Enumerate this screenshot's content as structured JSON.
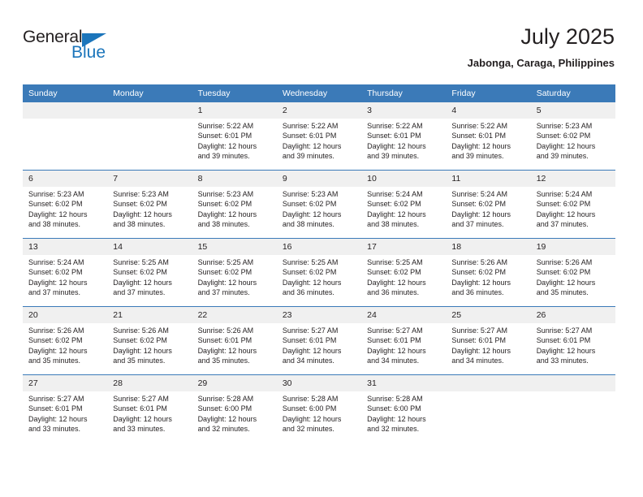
{
  "brand": {
    "name_dark": "General",
    "name_blue": "Blue",
    "accent_color": "#1b75bb"
  },
  "header": {
    "title": "July 2025",
    "subtitle": "Jabonga, Caraga, Philippines"
  },
  "calendar": {
    "header_color": "#3b7ab8",
    "daynum_band_color": "#f0f0f0",
    "weekday_headers": [
      "Sunday",
      "Monday",
      "Tuesday",
      "Wednesday",
      "Thursday",
      "Friday",
      "Saturday"
    ],
    "weeks": [
      [
        {
          "day": "",
          "lines": []
        },
        {
          "day": "",
          "lines": []
        },
        {
          "day": "1",
          "lines": [
            "Sunrise: 5:22 AM",
            "Sunset: 6:01 PM",
            "Daylight: 12 hours",
            "and 39 minutes."
          ]
        },
        {
          "day": "2",
          "lines": [
            "Sunrise: 5:22 AM",
            "Sunset: 6:01 PM",
            "Daylight: 12 hours",
            "and 39 minutes."
          ]
        },
        {
          "day": "3",
          "lines": [
            "Sunrise: 5:22 AM",
            "Sunset: 6:01 PM",
            "Daylight: 12 hours",
            "and 39 minutes."
          ]
        },
        {
          "day": "4",
          "lines": [
            "Sunrise: 5:22 AM",
            "Sunset: 6:01 PM",
            "Daylight: 12 hours",
            "and 39 minutes."
          ]
        },
        {
          "day": "5",
          "lines": [
            "Sunrise: 5:23 AM",
            "Sunset: 6:02 PM",
            "Daylight: 12 hours",
            "and 39 minutes."
          ]
        }
      ],
      [
        {
          "day": "6",
          "lines": [
            "Sunrise: 5:23 AM",
            "Sunset: 6:02 PM",
            "Daylight: 12 hours",
            "and 38 minutes."
          ]
        },
        {
          "day": "7",
          "lines": [
            "Sunrise: 5:23 AM",
            "Sunset: 6:02 PM",
            "Daylight: 12 hours",
            "and 38 minutes."
          ]
        },
        {
          "day": "8",
          "lines": [
            "Sunrise: 5:23 AM",
            "Sunset: 6:02 PM",
            "Daylight: 12 hours",
            "and 38 minutes."
          ]
        },
        {
          "day": "9",
          "lines": [
            "Sunrise: 5:23 AM",
            "Sunset: 6:02 PM",
            "Daylight: 12 hours",
            "and 38 minutes."
          ]
        },
        {
          "day": "10",
          "lines": [
            "Sunrise: 5:24 AM",
            "Sunset: 6:02 PM",
            "Daylight: 12 hours",
            "and 38 minutes."
          ]
        },
        {
          "day": "11",
          "lines": [
            "Sunrise: 5:24 AM",
            "Sunset: 6:02 PM",
            "Daylight: 12 hours",
            "and 37 minutes."
          ]
        },
        {
          "day": "12",
          "lines": [
            "Sunrise: 5:24 AM",
            "Sunset: 6:02 PM",
            "Daylight: 12 hours",
            "and 37 minutes."
          ]
        }
      ],
      [
        {
          "day": "13",
          "lines": [
            "Sunrise: 5:24 AM",
            "Sunset: 6:02 PM",
            "Daylight: 12 hours",
            "and 37 minutes."
          ]
        },
        {
          "day": "14",
          "lines": [
            "Sunrise: 5:25 AM",
            "Sunset: 6:02 PM",
            "Daylight: 12 hours",
            "and 37 minutes."
          ]
        },
        {
          "day": "15",
          "lines": [
            "Sunrise: 5:25 AM",
            "Sunset: 6:02 PM",
            "Daylight: 12 hours",
            "and 37 minutes."
          ]
        },
        {
          "day": "16",
          "lines": [
            "Sunrise: 5:25 AM",
            "Sunset: 6:02 PM",
            "Daylight: 12 hours",
            "and 36 minutes."
          ]
        },
        {
          "day": "17",
          "lines": [
            "Sunrise: 5:25 AM",
            "Sunset: 6:02 PM",
            "Daylight: 12 hours",
            "and 36 minutes."
          ]
        },
        {
          "day": "18",
          "lines": [
            "Sunrise: 5:26 AM",
            "Sunset: 6:02 PM",
            "Daylight: 12 hours",
            "and 36 minutes."
          ]
        },
        {
          "day": "19",
          "lines": [
            "Sunrise: 5:26 AM",
            "Sunset: 6:02 PM",
            "Daylight: 12 hours",
            "and 35 minutes."
          ]
        }
      ],
      [
        {
          "day": "20",
          "lines": [
            "Sunrise: 5:26 AM",
            "Sunset: 6:02 PM",
            "Daylight: 12 hours",
            "and 35 minutes."
          ]
        },
        {
          "day": "21",
          "lines": [
            "Sunrise: 5:26 AM",
            "Sunset: 6:02 PM",
            "Daylight: 12 hours",
            "and 35 minutes."
          ]
        },
        {
          "day": "22",
          "lines": [
            "Sunrise: 5:26 AM",
            "Sunset: 6:01 PM",
            "Daylight: 12 hours",
            "and 35 minutes."
          ]
        },
        {
          "day": "23",
          "lines": [
            "Sunrise: 5:27 AM",
            "Sunset: 6:01 PM",
            "Daylight: 12 hours",
            "and 34 minutes."
          ]
        },
        {
          "day": "24",
          "lines": [
            "Sunrise: 5:27 AM",
            "Sunset: 6:01 PM",
            "Daylight: 12 hours",
            "and 34 minutes."
          ]
        },
        {
          "day": "25",
          "lines": [
            "Sunrise: 5:27 AM",
            "Sunset: 6:01 PM",
            "Daylight: 12 hours",
            "and 34 minutes."
          ]
        },
        {
          "day": "26",
          "lines": [
            "Sunrise: 5:27 AM",
            "Sunset: 6:01 PM",
            "Daylight: 12 hours",
            "and 33 minutes."
          ]
        }
      ],
      [
        {
          "day": "27",
          "lines": [
            "Sunrise: 5:27 AM",
            "Sunset: 6:01 PM",
            "Daylight: 12 hours",
            "and 33 minutes."
          ]
        },
        {
          "day": "28",
          "lines": [
            "Sunrise: 5:27 AM",
            "Sunset: 6:01 PM",
            "Daylight: 12 hours",
            "and 33 minutes."
          ]
        },
        {
          "day": "29",
          "lines": [
            "Sunrise: 5:28 AM",
            "Sunset: 6:00 PM",
            "Daylight: 12 hours",
            "and 32 minutes."
          ]
        },
        {
          "day": "30",
          "lines": [
            "Sunrise: 5:28 AM",
            "Sunset: 6:00 PM",
            "Daylight: 12 hours",
            "and 32 minutes."
          ]
        },
        {
          "day": "31",
          "lines": [
            "Sunrise: 5:28 AM",
            "Sunset: 6:00 PM",
            "Daylight: 12 hours",
            "and 32 minutes."
          ]
        },
        {
          "day": "",
          "lines": []
        },
        {
          "day": "",
          "lines": []
        }
      ]
    ]
  }
}
